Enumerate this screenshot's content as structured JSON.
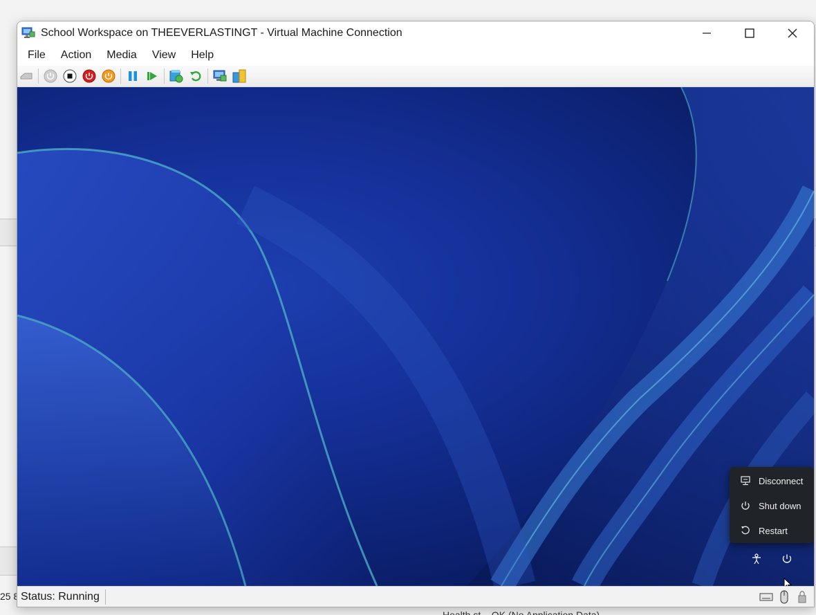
{
  "window": {
    "title": "School Workspace on THEEVERLASTINGT - Virtual Machine Connection"
  },
  "menu": [
    "File",
    "Action",
    "Media",
    "View",
    "Help"
  ],
  "toolbar": {
    "buttons": [
      "ctrl-alt-del",
      "start",
      "turn-off",
      "shut-down",
      "save",
      "pause",
      "reset",
      "checkpoint",
      "revert",
      "enhanced-session",
      "share"
    ]
  },
  "power_menu": {
    "items": [
      {
        "label": "Disconnect",
        "icon": "disconnect-icon"
      },
      {
        "label": "Shut down",
        "icon": "power-icon"
      },
      {
        "label": "Restart",
        "icon": "restart-icon"
      }
    ]
  },
  "status": {
    "text": "Status: Running"
  },
  "background": {
    "left_edge_fragment": "25 8",
    "bottom_fragment": "Health st... OK (No Application Data)"
  },
  "colors": {
    "wallpaper_deep": "#061245",
    "wallpaper_mid": "#142f96",
    "menu_bg": "#202328"
  }
}
